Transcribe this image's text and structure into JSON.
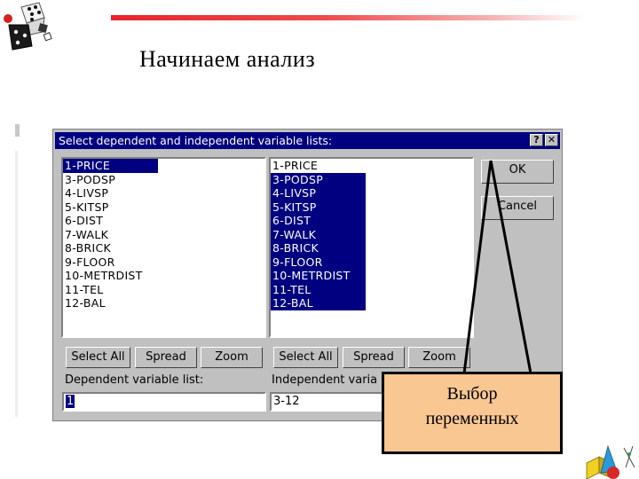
{
  "slide": {
    "title": "Начинаем анализ"
  },
  "dialog": {
    "title": "Select dependent and independent variable lists:",
    "help_label": "?",
    "close_label": "✕",
    "left_list": [
      {
        "label": "1-PRICE",
        "selected": true
      },
      {
        "label": "3-PODSP",
        "selected": false
      },
      {
        "label": "4-LIVSP",
        "selected": false
      },
      {
        "label": "5-KITSP",
        "selected": false
      },
      {
        "label": "6-DIST",
        "selected": false
      },
      {
        "label": "7-WALK",
        "selected": false
      },
      {
        "label": "8-BRICK",
        "selected": false
      },
      {
        "label": "9-FLOOR",
        "selected": false
      },
      {
        "label": "10-METRDIST",
        "selected": false
      },
      {
        "label": "11-TEL",
        "selected": false
      },
      {
        "label": "12-BAL",
        "selected": false
      }
    ],
    "right_list": [
      {
        "label": "1-PRICE",
        "selected": false
      },
      {
        "label": "3-PODSP",
        "selected": true
      },
      {
        "label": "4-LIVSP",
        "selected": true
      },
      {
        "label": "5-KITSP",
        "selected": true
      },
      {
        "label": "6-DIST",
        "selected": true
      },
      {
        "label": "7-WALK",
        "selected": true
      },
      {
        "label": "8-BRICK",
        "selected": true
      },
      {
        "label": "9-FLOOR",
        "selected": true
      },
      {
        "label": "10-METRDIST",
        "selected": true
      },
      {
        "label": "11-TEL",
        "selected": true
      },
      {
        "label": "12-BAL",
        "selected": true
      }
    ],
    "ok_label": "OK",
    "cancel_label": "Cancel",
    "left_buttons": {
      "select_all": "Select All",
      "spread": "Spread",
      "zoom": "Zoom"
    },
    "right_buttons": {
      "select_all": "Select All",
      "spread": "Spread",
      "zoom": "Zoom"
    },
    "dependent_label": "Dependent variable list:",
    "independent_label": "Independent varia",
    "dependent_value": "1",
    "independent_value": "3-12"
  },
  "callout": {
    "line1": "Выбор",
    "line2": "переменных"
  },
  "colors": {
    "accent_line": "#e8242a",
    "selection": "#000080",
    "callout_fill": "#f9c792"
  }
}
